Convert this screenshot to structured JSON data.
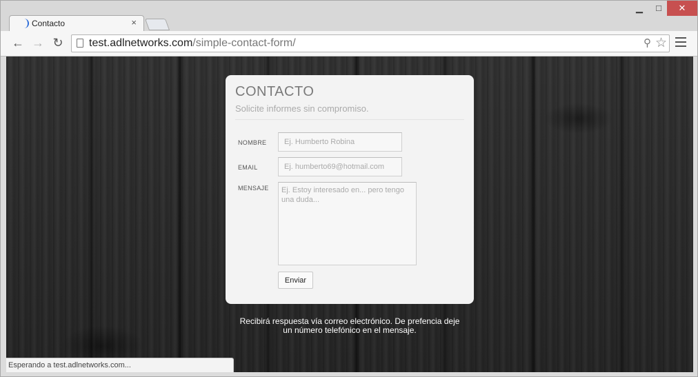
{
  "browser": {
    "tab_title": "Contacto",
    "tab_close": "×",
    "window_controls": {
      "minimize": "▁",
      "maximize": "□",
      "close": "✕"
    },
    "url_host": "test.adlnetworks.com",
    "url_path": "/simple-contact-form/",
    "status_text": "Esperando a test.adlnetworks.com...",
    "icons": {
      "back": "back-arrow-icon",
      "forward": "forward-arrow-icon",
      "reload": "reload-icon",
      "zoom": "zoom-icon",
      "bookmark": "star-icon",
      "menu": "menu-icon"
    }
  },
  "form": {
    "title": "CONTACTO",
    "subtitle": "Solicite informes sin compromiso.",
    "fields": {
      "name_label": "NOMBRE",
      "name_placeholder": "Ej. Humberto Robina",
      "email_label": "EMAIL",
      "email_placeholder": "Ej. humberto69@hotmail.com",
      "message_label": "MENSAJE",
      "message_placeholder": "Ej. Estoy interesado en... pero tengo una duda..."
    },
    "submit_label": "Enviar"
  },
  "footer": {
    "line1": "Recibirá respuesta vía correo electrónico. De prefencia deje",
    "line2": "un número telefónico en el mensaje."
  },
  "colors": {
    "card_bg": "#f3f3f3",
    "title": "#7a7a7a",
    "subtitle": "#aaaaaa",
    "close_button": "#c75050",
    "loading_spinner": "#2b6bd8"
  }
}
